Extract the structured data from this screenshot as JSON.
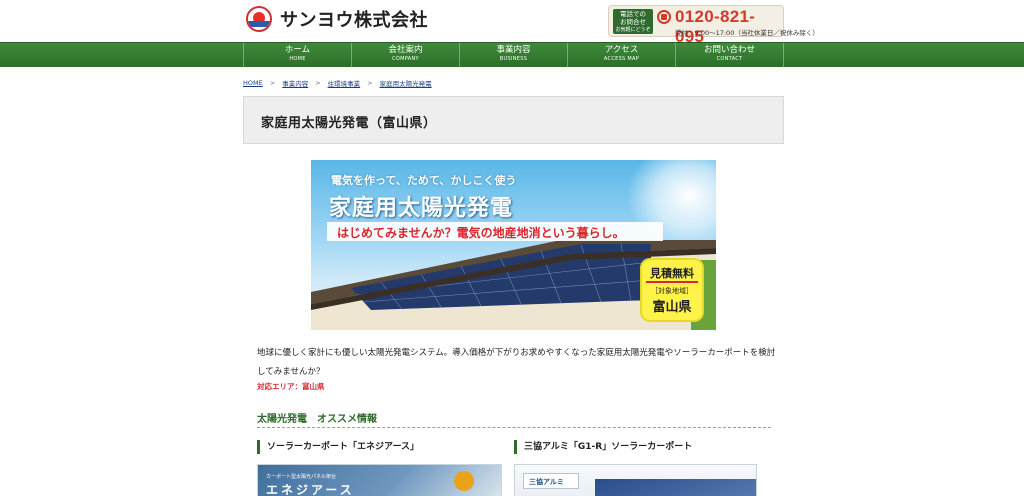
{
  "header": {
    "company_name": "サンヨウ株式会社",
    "tel": {
      "label_line1": "電話での",
      "label_line2": "お問合せ",
      "label_line3": "お気軽にどうぞ",
      "number": "0120-821-095",
      "hours": "受付：9:00～17:00（当社休業日／祝休み除く）"
    }
  },
  "nav": {
    "items": [
      {
        "label": "ホーム",
        "sub": "HOME"
      },
      {
        "label": "会社案内",
        "sub": "COMPANY"
      },
      {
        "label": "事業内容",
        "sub": "BUSINESS"
      },
      {
        "label": "アクセス",
        "sub": "ACCESS MAP"
      },
      {
        "label": "お問い合わせ",
        "sub": "CONTACT"
      }
    ]
  },
  "breadcrumb": {
    "items": [
      "HOME",
      "事業内容",
      "住環境事業",
      "家庭用太陽光発電"
    ],
    "separator": ">"
  },
  "page": {
    "title": "家庭用太陽光発電（富山県）"
  },
  "hero": {
    "subtitle": "電気を作って、ためて、かしこく使う",
    "title": "家庭用太陽光発電",
    "tagline": "はじめてみませんか？電気の地産地消という暮らし。",
    "badge_line1": "見積無料",
    "badge_line2": "［対象地域］",
    "badge_line3": "富山県"
  },
  "content": {
    "intro": "地球に優しく家計にも優しい太陽光発電システム。導入価格が下がりお求めやすくなった家庭用太陽光発電やソーラーカーポートを検討してみませんか？",
    "area": "対応エリア：富山県",
    "section_title": "太陽光発電　オススメ情報",
    "cards": [
      {
        "title": "ソーラーカーポート「エネジアース」",
        "img_caption": "カーポート型太陽光パネル架台",
        "img_title": "エネジアース"
      },
      {
        "title": "三協アルミ「G1-R」ソーラーカーポート",
        "img_brand": "三協アルミ"
      }
    ]
  },
  "colors": {
    "nav_green": "#2c6e28",
    "accent_red": "#d9262c",
    "badge_yellow": "#fff34a"
  }
}
